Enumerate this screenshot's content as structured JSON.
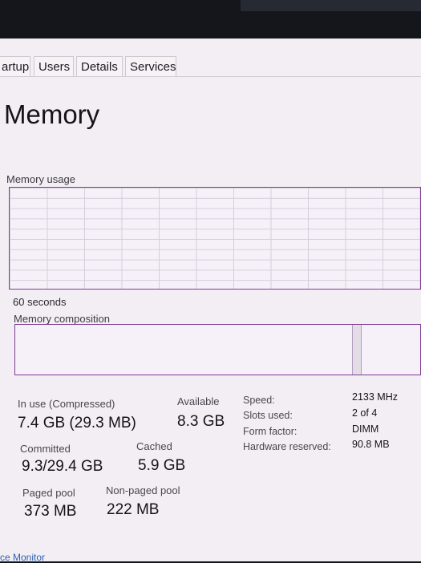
{
  "tabs": [
    "artup",
    "Users",
    "Details",
    "Services"
  ],
  "page_title": "Memory",
  "memory_usage_label": "Memory usage",
  "time_window_label": "60 seconds",
  "memory_composition_label": "Memory composition",
  "stats": {
    "in_use_label": "In use (Compressed)",
    "in_use_value": "7.4 GB (29.3 MB)",
    "available_label": "Available",
    "available_value": "8.3 GB",
    "committed_label": "Committed",
    "committed_value": "9.3/29.4 GB",
    "cached_label": "Cached",
    "cached_value": "5.9 GB",
    "paged_pool_label": "Paged pool",
    "paged_pool_value": "373 MB",
    "non_paged_pool_label": "Non-paged pool",
    "non_paged_pool_value": "222 MB"
  },
  "hardware": {
    "speed_label": "Speed:",
    "speed_value": "2133 MHz",
    "slots_label": "Slots used:",
    "slots_value": "2 of 4",
    "form_factor_label": "Form factor:",
    "form_factor_value": "DIMM",
    "hw_reserved_label": "Hardware reserved:",
    "hw_reserved_value": "90.8 MB"
  },
  "footer_link": "ce Monitor",
  "colors": {
    "accent": "#7e3f93",
    "background": "#f3eef3",
    "link": "#2a63b5"
  }
}
